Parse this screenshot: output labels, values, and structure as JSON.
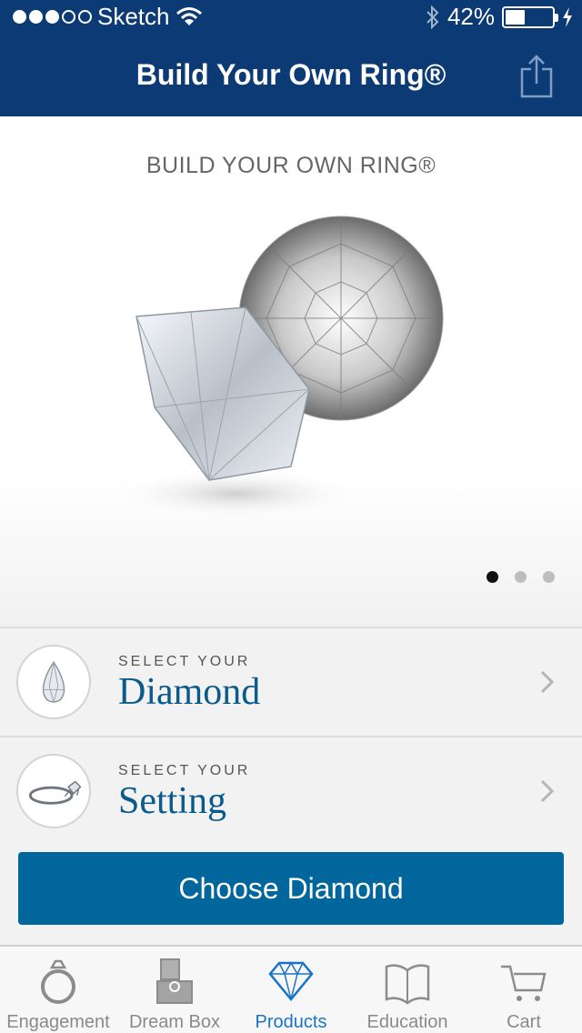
{
  "status_bar": {
    "carrier": "Sketch",
    "battery_percent": "42%",
    "battery_level": 0.42
  },
  "nav": {
    "title": "Build Your Own Ring®"
  },
  "hero": {
    "title": "BUILD YOUR OWN RING®",
    "pages": 3,
    "active_page": 1
  },
  "selectors": [
    {
      "kicker": "SELECT YOUR",
      "label": "Diamond"
    },
    {
      "kicker": "SELECT YOUR",
      "label": "Setting"
    }
  ],
  "cta": {
    "label": "Choose Diamond"
  },
  "tabs": [
    {
      "label": "Engagement",
      "icon": "ring-icon"
    },
    {
      "label": "Dream Box",
      "icon": "ring-box-icon"
    },
    {
      "label": "Products",
      "icon": "diamond-icon",
      "active": true
    },
    {
      "label": "Education",
      "icon": "book-icon"
    },
    {
      "label": "Cart",
      "icon": "cart-icon"
    }
  ],
  "colors": {
    "nav_bg": "#0b3a74",
    "accent": "#01669c",
    "active_tab": "#1a73c6"
  }
}
